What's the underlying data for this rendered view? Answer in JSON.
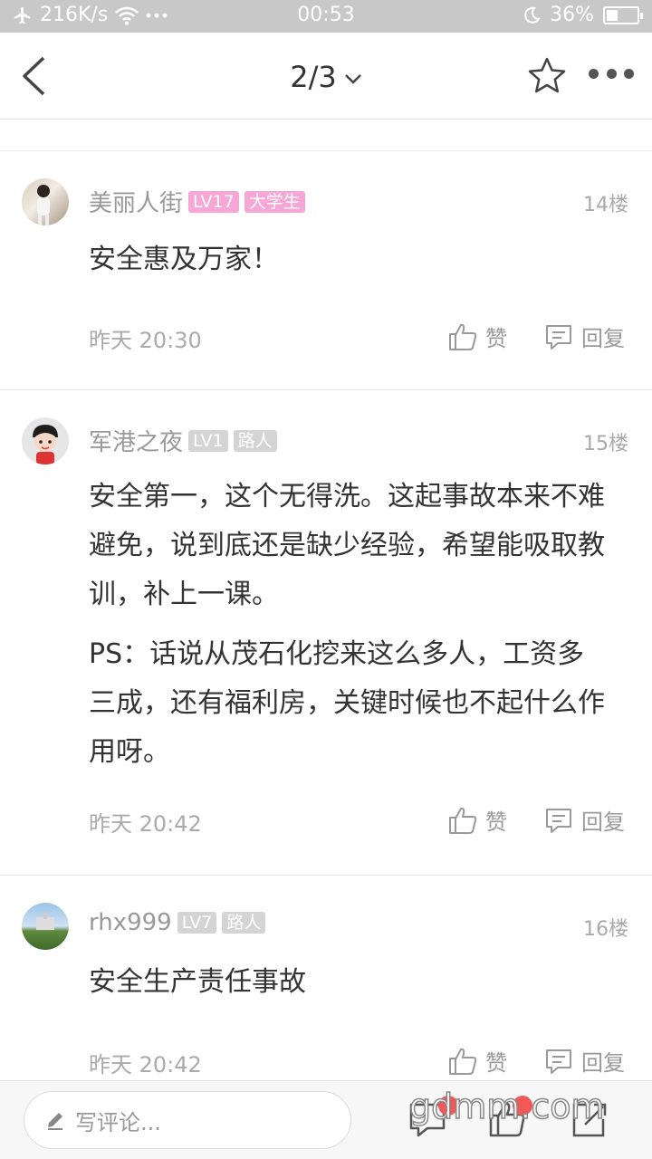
{
  "status_bar": {
    "network_speed": "216K/s",
    "time": "00:53",
    "battery_percent": "36%",
    "battery_level": 0.36,
    "icons": [
      "airplane-icon",
      "wifi-icon",
      "more-dots-icon",
      "moon-icon",
      "battery-icon"
    ]
  },
  "nav": {
    "page_indicator": "2/3",
    "icons": [
      "back-icon",
      "chevron-down-icon",
      "star-icon",
      "more-icon"
    ]
  },
  "comments": [
    {
      "username": "美丽人街",
      "level": "LV17",
      "title": "大学生",
      "badge_color": "#f6a7d6",
      "floor": "14楼",
      "text": [
        "安全惠及万家！"
      ],
      "time": "昨天 20:30",
      "like_label": "赞",
      "reply_label": "回复"
    },
    {
      "username": "军港之夜",
      "level": "LV1",
      "title": "路人",
      "badge_color": "#d4d4d4",
      "floor": "15楼",
      "text": [
        "安全第一，这个无得洗。这起事故本来不难避免，说到底还是缺少经验，希望能吸取教训，补上一课。",
        "PS：话说从茂石化挖来这么多人，工资多三成，还有福利房，关键时候也不起什么作用呀。"
      ],
      "time": "昨天 20:42",
      "like_label": "赞",
      "reply_label": "回复"
    },
    {
      "username": "rhx999",
      "level": "LV7",
      "title": "路人",
      "badge_color": "#d4d4d4",
      "floor": "16楼",
      "text": [
        "安全生产责任事故"
      ],
      "time": "昨天 20:42",
      "like_label": "赞",
      "reply_label": "回复"
    }
  ],
  "bottom_bar": {
    "comment_placeholder": "写评论...",
    "icons": [
      "comments-icon",
      "like-icon",
      "share-icon"
    ],
    "notification_color": "#f15858"
  },
  "watermark": "gdmm.com"
}
